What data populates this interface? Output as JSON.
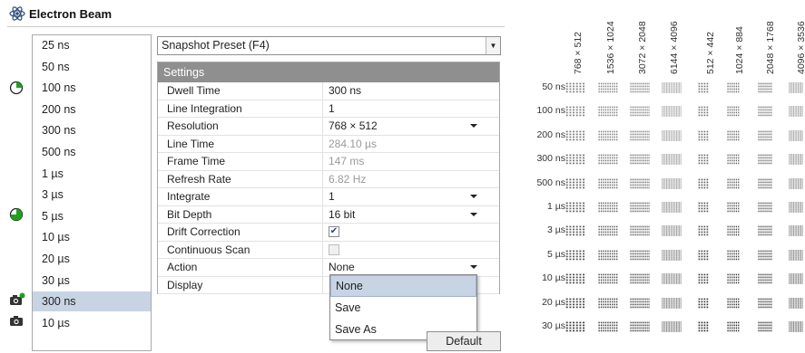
{
  "panel": {
    "title": "Electron Beam",
    "icons": [
      "atom-icon",
      "pie-quarter-icon",
      "pie-three-quarter-icon",
      "camera-new-icon",
      "camera-icon"
    ]
  },
  "time_list": {
    "items": [
      "25 ns",
      "50 ns",
      "100 ns",
      "200 ns",
      "300 ns",
      "500 ns",
      "1 µs",
      "3 µs",
      "5 µs",
      "10 µs",
      "20 µs",
      "30 µs",
      "300 ns",
      "10 µs"
    ],
    "selected_index": 12
  },
  "preset": {
    "value": "Snapshot Preset (F4)"
  },
  "settings": {
    "header": "Settings",
    "rows": [
      {
        "key": "Dwell Time",
        "value": "300 ns"
      },
      {
        "key": "Line Integration",
        "value": "1"
      },
      {
        "key": "Resolution",
        "value": "768 × 512"
      },
      {
        "key": "Line Time",
        "value": "284.10 µs"
      },
      {
        "key": "Frame Time",
        "value": "147 ms"
      },
      {
        "key": "Refresh Rate",
        "value": "6.82 Hz"
      },
      {
        "key": "Integrate",
        "value": "1"
      },
      {
        "key": "Bit Depth",
        "value": "16 bit"
      },
      {
        "key": "Drift Correction",
        "value": ""
      },
      {
        "key": "Continuous Scan",
        "value": ""
      },
      {
        "key": "Action",
        "value": "None"
      },
      {
        "key": "Display",
        "value": ""
      }
    ],
    "drift_correction_checked": true,
    "continuous_scan_checked": false
  },
  "action_dropdown": {
    "options": [
      "None",
      "Save",
      "Save As"
    ],
    "selected": "None"
  },
  "buttons": {
    "default": "Default"
  },
  "matrix": {
    "columns": [
      "768 × 512",
      "1536 × 1024",
      "3072 × 2048",
      "6144 × 4096",
      "512 × 442",
      "1024 × 884",
      "2048 × 1768",
      "4096 × 3536"
    ],
    "rows": [
      "50 ns",
      "100 ns",
      "200 ns",
      "300 ns",
      "500 ns",
      "1 µs",
      "3 µs",
      "5 µs",
      "10 µs",
      "20 µs",
      "30 µs"
    ]
  },
  "colors": {
    "selection": "#c8d4e4",
    "header": "#8f8f8f",
    "green": "#1fa11f"
  }
}
